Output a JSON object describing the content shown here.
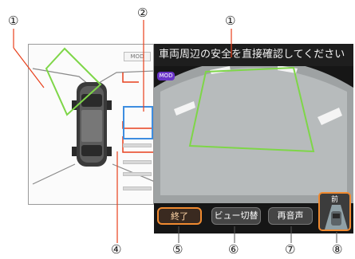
{
  "callouts": {
    "n1_left": "①",
    "n2": "②",
    "n1_right": "①",
    "n4": "④",
    "n5": "⑤",
    "n6": "⑥",
    "n7": "⑦",
    "n8": "⑧"
  },
  "top_view": {
    "mod_label": "MOD"
  },
  "camera_view": {
    "message": "車両周辺の安全を直接確認してください",
    "mod_badge": "MOD"
  },
  "buttons": {
    "end_label": "終了",
    "view_switch_label": "ビュー切替",
    "replay_label": "再音声",
    "mini_label": "前"
  },
  "colors": {
    "guide_green": "#7ed648",
    "callout_red": "#e8401c",
    "highlight_blue": "#3d8de0",
    "accent_orange": "#f08a30",
    "mod_badge": "#6a35c8"
  }
}
